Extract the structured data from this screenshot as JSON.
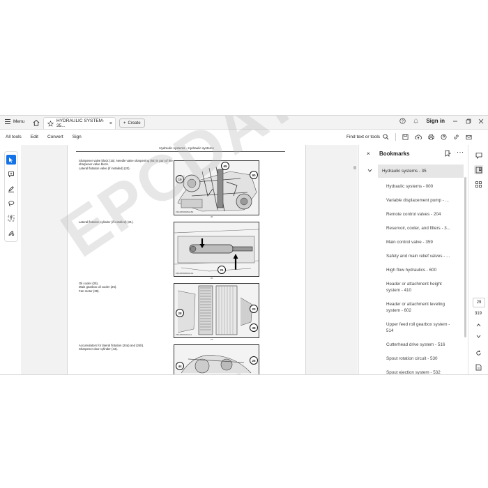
{
  "titlebar": {
    "menu_label": "Menu",
    "tab_title": "HYDRAULIC SYSTEM-35...",
    "create_label": "Create",
    "signin_label": "Sign in"
  },
  "toolbar": {
    "items": [
      "All tools",
      "Edit",
      "Convert",
      "Sign"
    ],
    "find_label": "Find text or tools"
  },
  "document": {
    "page_header": "Hydraulic systems - Hydraulic systems",
    "paragraphs": [
      "Sharpener valve block (15). Needle valve sharpening (65) is part of the sharpener valve block.",
      "Lateral flotation valve (if installed) (20).",
      "Lateral flotation cylinder (if installed) (21).",
      "Oil cooler (25).",
      "Main gearbox oil cooler (26).",
      "Fan motor (39).",
      "Accumulators for lateral flotation (24a) and (24b).",
      "Sharpener door cylinder (44)."
    ],
    "figure1": {
      "callouts": [
        "65",
        "19",
        "90"
      ],
      "code": "ZDL08FR008A1B2",
      "num": "20"
    },
    "figure2": {
      "callouts": [
        "21"
      ],
      "code": "ZDL08FR009A1A2",
      "num": "20"
    },
    "figure3": {
      "callouts": [
        "28",
        "23",
        "38"
      ],
      "code": "ZDL08FR010A11",
      "num": "21"
    },
    "figure4": {
      "callouts": [
        "44",
        "26"
      ]
    },
    "watermark": "EPCDATO.COM"
  },
  "bookmarks": {
    "title": "Bookmarks",
    "items": [
      "Hydraulic systems - 35",
      "Hydraulic systems - 000",
      "Variable displacement pump - ...",
      "Remote control valves - 204",
      "Reservoir, cooler, and filters - 3...",
      "Main control valve - 359",
      "Safety and main relief valves - ...",
      "High flow hydraulics - 600",
      "Header or attachment height system - 410",
      "Header or attachment leveling system - 602",
      "Upper feed roll gearbox system - 514",
      "Cutterhead drive system - 516",
      "Spout rotation circuit - 530",
      "Spout ejection system - 532"
    ]
  },
  "navigation": {
    "current_page": "29",
    "total_pages": "319"
  },
  "colors": {
    "accent": "#1473e6",
    "selected_bg": "#e6e6e6"
  }
}
